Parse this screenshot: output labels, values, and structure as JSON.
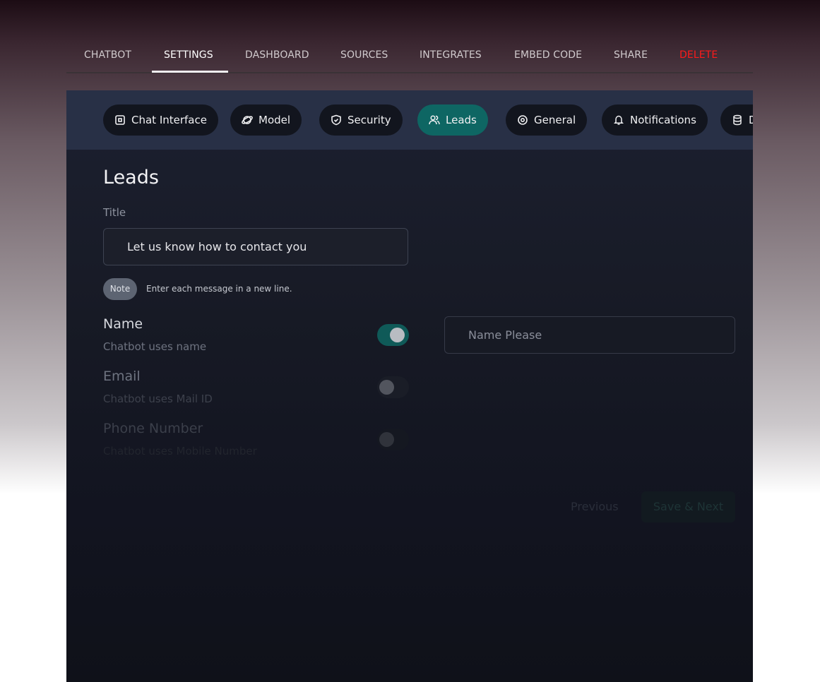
{
  "top_tabs": [
    {
      "label": "CHATBOT"
    },
    {
      "label": "SETTINGS"
    },
    {
      "label": "DASHBOARD"
    },
    {
      "label": "SOURCES"
    },
    {
      "label": "INTEGRATES"
    },
    {
      "label": "EMBED CODE"
    },
    {
      "label": "SHARE"
    },
    {
      "label": "DELETE"
    }
  ],
  "settings_tabs": [
    {
      "label": "Chat Interface",
      "icon": "chat-interface-icon"
    },
    {
      "label": "Model",
      "icon": "planet-icon"
    },
    {
      "label": "Security",
      "icon": "shield-icon"
    },
    {
      "label": "Leads",
      "icon": "users-icon"
    },
    {
      "label": "General",
      "icon": "target-icon"
    },
    {
      "label": "Notifications",
      "icon": "bell-icon"
    },
    {
      "label": "D",
      "icon": "database-icon"
    }
  ],
  "leads": {
    "heading": "Leads",
    "title_label": "Title",
    "title_value": "Let us know how to contact you",
    "note_badge": "Note",
    "note_text": "Enter each message in a new line.",
    "fields": [
      {
        "title": "Name",
        "subtitle": "Chatbot uses name",
        "enabled": true
      },
      {
        "title": "Email",
        "subtitle": "Chatbot uses Mail ID",
        "enabled": false
      },
      {
        "title": "Phone Number",
        "subtitle": "Chatbot uses Mobile Number",
        "enabled": false
      }
    ],
    "name_placeholder": "Name Please"
  },
  "footer": {
    "previous_label": "Previous",
    "save_label": "Save & Next"
  },
  "colors": {
    "accent": "#0e6663",
    "delete": "#ff1a1a"
  }
}
